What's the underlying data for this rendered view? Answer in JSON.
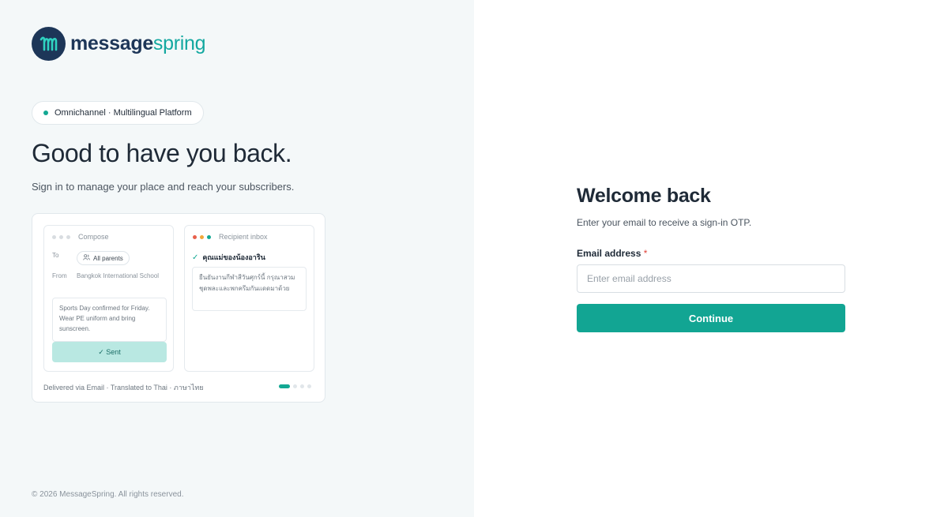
{
  "brand": {
    "name_part1": "message",
    "name_part2": "spring",
    "logo_icon": "wave-m-icon",
    "colors": {
      "navy": "#1d3658",
      "teal": "#13a8a0"
    }
  },
  "hero": {
    "badge": "Omnichannel · Multilingual Platform",
    "headline": "Good to have you back.",
    "subline": "Sign in to manage your place and reach your subscribers."
  },
  "preview": {
    "compose": {
      "title": "Compose",
      "to_label": "To",
      "to_value": "All parents",
      "from_label": "From",
      "from_value": "Bangkok International School",
      "message": "Sports Day confirmed for Friday. Wear PE uniform and bring sunscreen.",
      "sent_label": "✓ Sent"
    },
    "inbox": {
      "title": "Recipient inbox",
      "recipient": "คุณแม่ของน้องอาริน",
      "message": "ยืนยันงานกีฬาสีวันศุกร์นี้ กรุณาสวมชุดพละและพกครีมกันแดดมาด้วย"
    },
    "footer": "Delivered via Email · Translated to Thai · ภาษาไทย",
    "pager": {
      "total": 4,
      "active": 1
    }
  },
  "footer": {
    "copyright": "© 2026 MessageSpring. All rights reserved."
  },
  "form": {
    "title": "Welcome back",
    "subtitle": "Enter your email to receive a sign-in OTP.",
    "email_label": "Email address",
    "required_mark": "*",
    "email_placeholder": "Enter email address",
    "email_value": "",
    "submit_label": "Continue",
    "accent": "#12a593"
  }
}
